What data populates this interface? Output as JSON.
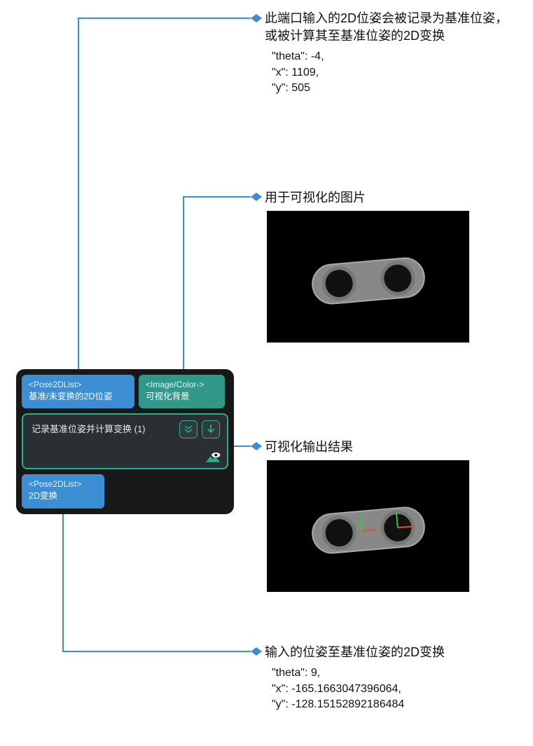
{
  "node": {
    "input_pose": {
      "type": "<Pose2DList>",
      "label": "基准/未变换的2D位姿"
    },
    "input_image": {
      "type": "<Image/Color->",
      "label": "可视化背景"
    },
    "title": "记录基准位姿并计算变换 (1)",
    "output_pose": {
      "type": "<Pose2DList>",
      "label": "2D变换"
    }
  },
  "anno1": {
    "title": "此端口输入的2D位姿会被记录为基准位姿，或被计算其至基准位姿的2D变换",
    "code": "\"theta\": -4,\n\"x\": 1109,\n\"y\": 505"
  },
  "anno2": {
    "title": "用于可视化的图片"
  },
  "anno3": {
    "title": "可视化输出结果"
  },
  "anno4": {
    "title": "输入的位姿至基准位姿的2D变换",
    "code": "\"theta\": 9,\n\"x\": -165.1663047396064,\n\"y\": -128.15152892186484"
  }
}
